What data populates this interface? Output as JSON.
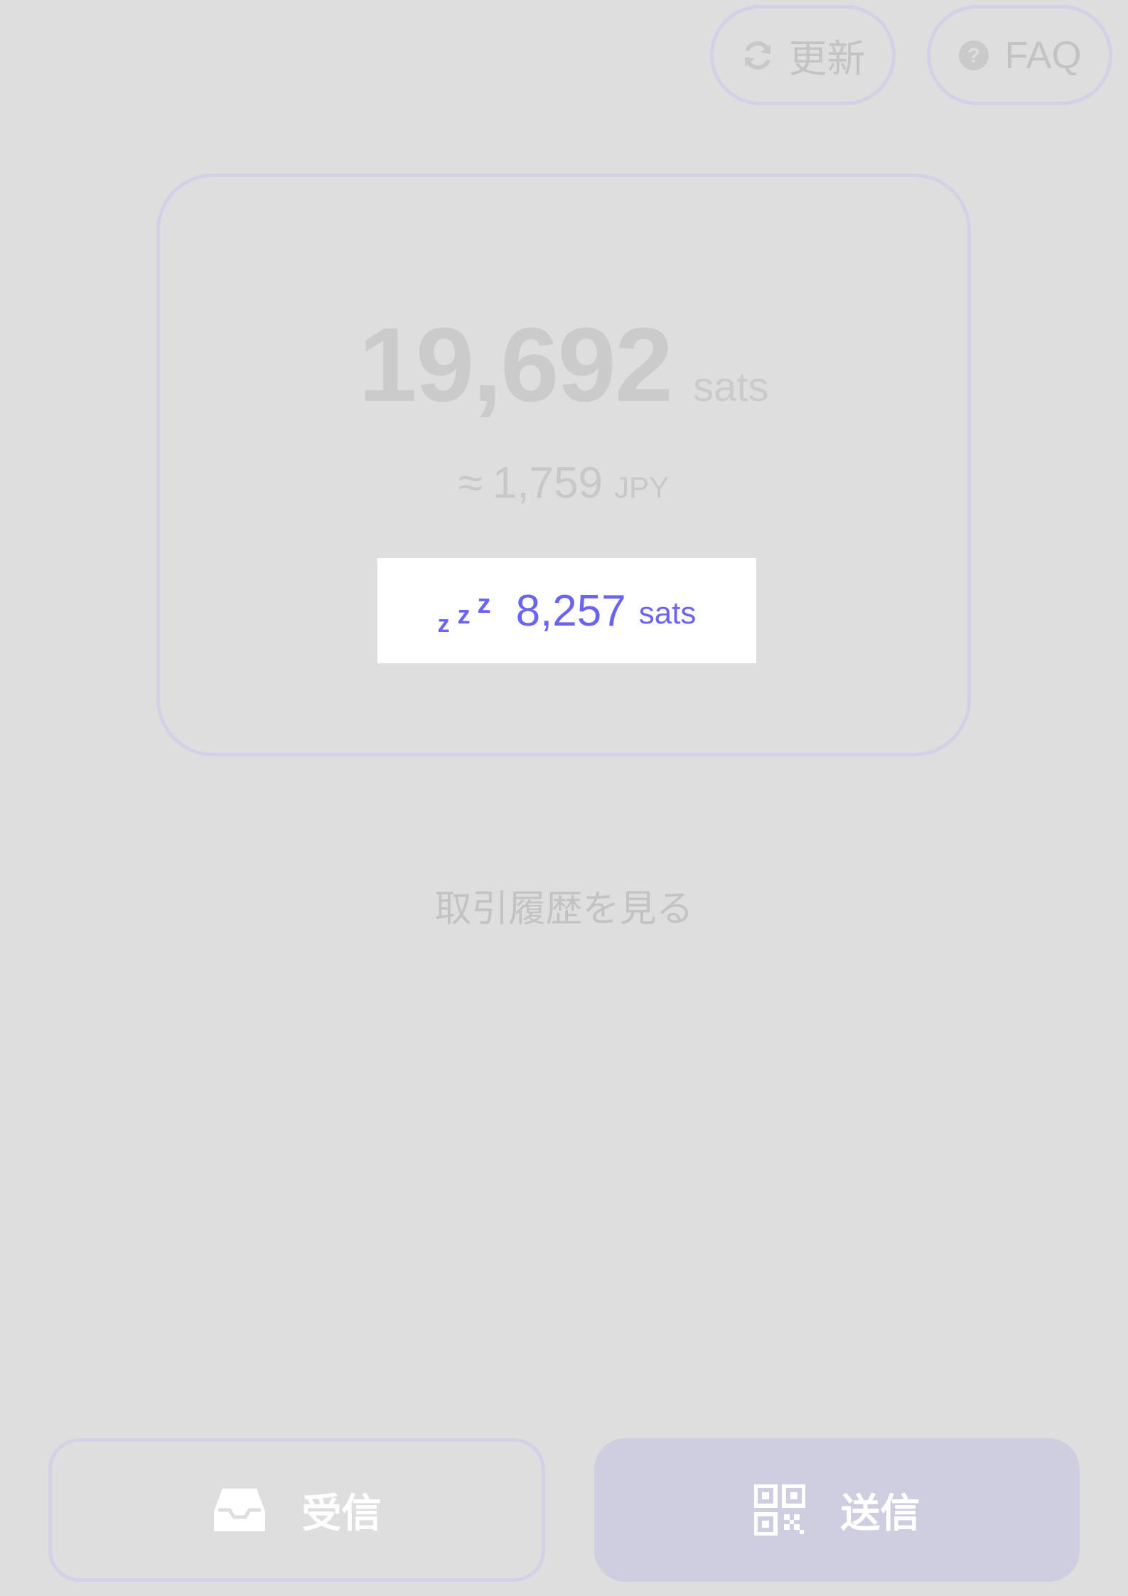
{
  "header": {
    "refresh_label": "更新",
    "refresh_icon": "refresh-icon",
    "faq_label": "FAQ",
    "faq_icon": "question-circle-icon"
  },
  "balance": {
    "value": "19,692",
    "unit": "sats",
    "fiat_approx_symbol": "≈",
    "fiat_value": "1,759",
    "fiat_currency": "JPY"
  },
  "pending": {
    "icon": "zzz-sleep-icon",
    "value": "8,257",
    "unit": "sats"
  },
  "history_link_label": "取引履歴を見る",
  "actions": {
    "receive_label": "受信",
    "receive_icon": "inbox-icon",
    "send_label": "送信",
    "send_icon": "qr-code-icon"
  },
  "colors": {
    "background": "#dedede",
    "accent": "#6b64f0",
    "border": "#d2d1e6",
    "muted_text": "#c3c3c3",
    "send_button_bg": "#cfcde0"
  }
}
